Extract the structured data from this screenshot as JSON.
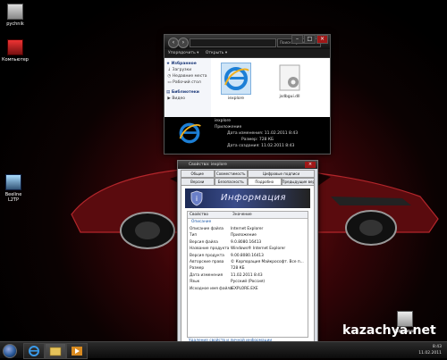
{
  "desktop": {
    "icons": [
      {
        "label": "pychnik"
      },
      {
        "label": "Компьютер"
      },
      {
        "label": "Beeline L2TP"
      },
      {
        "label": "Корзина"
      }
    ]
  },
  "explorer": {
    "search_placeholder": "Поиск: System32",
    "toolbar": {
      "organize": "Упорядочить ▾",
      "open": "Открыть ▾"
    },
    "nav": {
      "favorites": "Избранное",
      "items": [
        "Загрузки",
        "Недавние места",
        "Рабочий стол"
      ],
      "libraries": "Библиотеки",
      "lib_items": [
        "Видео"
      ]
    },
    "files": [
      {
        "name": "iexplore"
      },
      {
        "name": "jsdbgui.dll"
      }
    ],
    "details": {
      "name": "iexplore",
      "type": "Приложение",
      "modified": "Дата изменения: 11.02.2011 8:43",
      "size": "Размер: 728 КБ",
      "created": "Дата создания: 11.02.2011 8:43"
    }
  },
  "properties": {
    "title": "Свойства: iexplore",
    "tabs_row1": [
      "Общие",
      "Совместимость",
      "Цифровые подписи"
    ],
    "tabs_row2": [
      "Версии",
      "Безопасность",
      "Подробно",
      "Предыдущие версии"
    ],
    "banner_title": "Информация",
    "columns": {
      "property": "Свойство",
      "value": "Значение"
    },
    "group_label": "Описание",
    "rows": [
      {
        "k": "Описание файла",
        "v": "Internet Explorer"
      },
      {
        "k": "Тип",
        "v": "Приложение"
      },
      {
        "k": "Версия файла",
        "v": "9.0.8080.16413"
      },
      {
        "k": "Название продукта",
        "v": "Windows® Internet Explorer"
      },
      {
        "k": "Версия продукта",
        "v": "9.00.8080.16413"
      },
      {
        "k": "Авторские права",
        "v": "© Корпорация Майкрософт. Все п..."
      },
      {
        "k": "Размер",
        "v": "728 КБ"
      },
      {
        "k": "Дата изменения",
        "v": "11.02.2011 8:43"
      },
      {
        "k": "Язык",
        "v": "Русский (Россия)"
      },
      {
        "k": "Исходное имя файла",
        "v": "IEXPLORE.EXE"
      }
    ],
    "footer_link": "Удаление свойств и личной информации"
  },
  "taskbar": {
    "time": "8:43",
    "date": "11.02.2011"
  },
  "watermark": "kazachya.net"
}
